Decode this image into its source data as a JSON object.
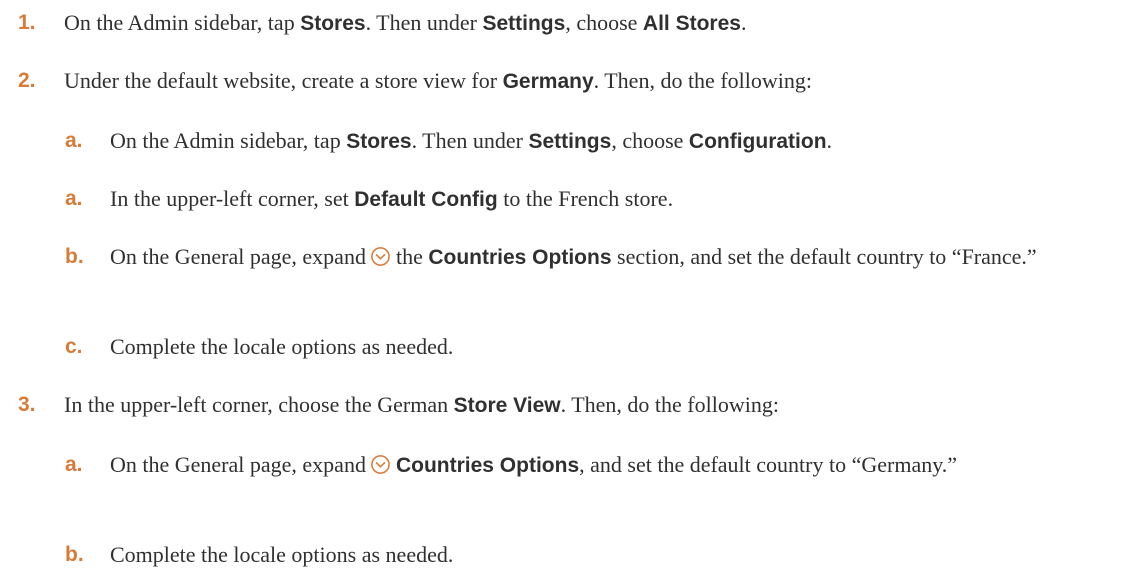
{
  "steps": [
    {
      "num": "1.",
      "t1": "On the Admin sidebar, tap ",
      "b1": "Stores",
      "t2": ". Then under ",
      "b2": "Settings",
      "t3": ", choose ",
      "b3": "All Stores",
      "t4": "."
    },
    {
      "num": "2.",
      "t1": "Under the default website, create a store view for ",
      "b1": "Germany",
      "t2": ". Then, do the following:",
      "substeps": [
        {
          "num": "a.",
          "t1": "On the Admin sidebar, tap ",
          "b1": "Stores",
          "t2": ". Then under ",
          "b2": "Settings",
          "t3": ", choose ",
          "b3": "Configuration",
          "t4": "."
        },
        {
          "num": "a.",
          "t1": "In the upper-left corner, set ",
          "b1": "Default Config",
          "t2": " to the French store."
        },
        {
          "num": "b.",
          "t1": "On the General page, expand",
          "icon": "expand-circle-chevron-icon",
          "t2": "the ",
          "b1": "Countries Options",
          "t3": " section, and set the default country to “France.”"
        },
        {
          "num": "c.",
          "t1": "Complete the locale options as needed."
        }
      ]
    },
    {
      "num": "3.",
      "t1": "In the upper-left corner, choose the German ",
      "b1": "Store View",
      "t2": ". Then, do the following:",
      "substeps": [
        {
          "num": "a.",
          "t1": "On the General page, expand",
          "icon": "expand-circle-chevron-icon",
          "b1": "Countries Options",
          "t2": ", and set the default country to “Germany.”"
        },
        {
          "num": "b.",
          "t1": "Complete the locale options as needed."
        }
      ]
    }
  ],
  "colors": {
    "step_number": "#d87a38",
    "text": "#303030",
    "icon": "#d87a38"
  }
}
